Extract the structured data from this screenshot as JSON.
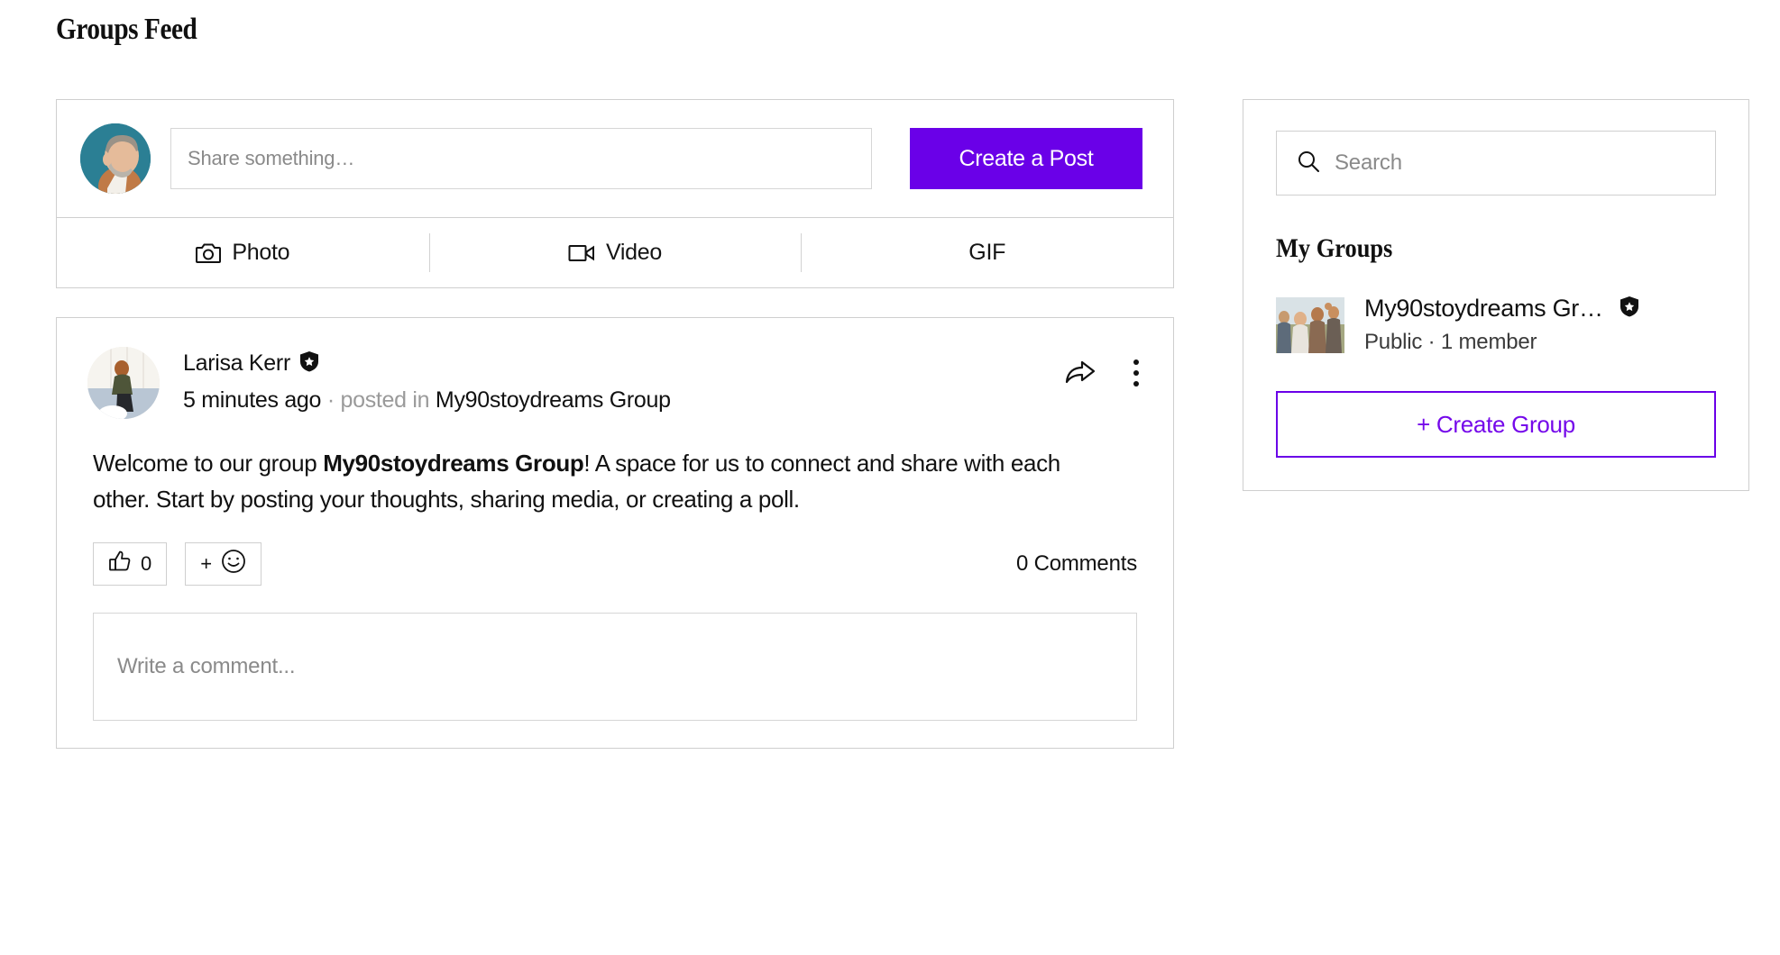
{
  "page": {
    "title": "Groups Feed",
    "accent_purple": "#6a00e8",
    "accent_purple_text": "#7509ea",
    "border_gray": "#cfcfcf",
    "muted_gray": "#8a8a8a"
  },
  "composer": {
    "avatar_name": "current-user-avatar",
    "input_placeholder": "Share something…",
    "input_value": "",
    "create_post_label": "Create a Post",
    "actions": [
      {
        "label": "Photo",
        "icon": "camera-icon"
      },
      {
        "label": "Video",
        "icon": "video-camera-icon"
      },
      {
        "label": "GIF",
        "icon": "gif-icon"
      }
    ]
  },
  "post": {
    "author": "Larisa Kerr",
    "author_badge": "shield-star-icon",
    "time": "5 minutes ago",
    "separator": "·",
    "posted_in_label": "posted in",
    "group_name": "My90stoydreams Group",
    "share_icon": "share-arrow-icon",
    "menu_icon": "more-vertical-icon",
    "body_before": "Welcome to our group ",
    "body_bold": "My90stoydreams Group",
    "body_after": "! A space for us to connect and share with each other. Start by posting your thoughts, sharing media, or creating a poll.",
    "like_icon": "thumbs-up-icon",
    "like_count": "0",
    "add_reaction_plus": "+",
    "add_reaction_icon": "smiley-icon",
    "comments_count_label": "0 Comments",
    "comment_placeholder": "Write a comment...",
    "comment_value": ""
  },
  "sidebar": {
    "search_placeholder": "Search",
    "search_value": "",
    "search_icon": "search-icon",
    "my_groups_title": "My Groups",
    "groups": [
      {
        "name": "My90stoydreams Gr…",
        "privacy": "Public",
        "separator": "·",
        "members": "1 member",
        "meta": "Public · 1 member",
        "badge": "shield-star-icon"
      }
    ],
    "create_group_label": "+ Create Group"
  }
}
